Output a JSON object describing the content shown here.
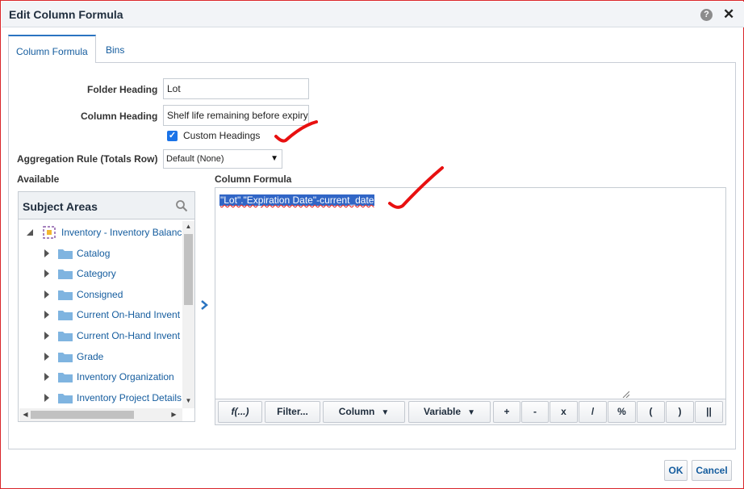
{
  "dialog": {
    "title": "Edit Column Formula"
  },
  "tabs": [
    {
      "label": "Column Formula",
      "active": true
    },
    {
      "label": "Bins",
      "active": false
    }
  ],
  "form": {
    "folder_heading_label": "Folder Heading",
    "folder_heading_value": "Lot",
    "column_heading_label": "Column Heading",
    "column_heading_value": "Shelf life remaining before expiry",
    "custom_headings_label": "Custom Headings",
    "custom_headings_checked": true,
    "aggregation_label": "Aggregation Rule (Totals Row)",
    "aggregation_value": "Default (None)"
  },
  "available": {
    "label": "Available",
    "subject_areas_title": "Subject Areas",
    "root": "Inventory - Inventory Balanc",
    "items": [
      "Catalog",
      "Category",
      "Consigned",
      "Current On-Hand Invent",
      "Current On-Hand Invent",
      "Grade",
      "Inventory Organization",
      "Inventory Project Details"
    ]
  },
  "formula": {
    "label": "Column Formula",
    "text": "\"Lot\".\"Expiration Date\"-current_date"
  },
  "toolbar": {
    "fx": "f(...)",
    "filter": "Filter...",
    "column": "Column",
    "variable": "Variable",
    "plus": "+",
    "minus": "-",
    "times": "x",
    "divide": "/",
    "percent": "%",
    "lparen": "(",
    "rparen": ")",
    "concat": "||"
  },
  "footer": {
    "ok": "OK",
    "cancel": "Cancel"
  },
  "colors": {
    "accent": "#2a74c1",
    "selection": "#3166c6",
    "annotation": "#e81010"
  }
}
